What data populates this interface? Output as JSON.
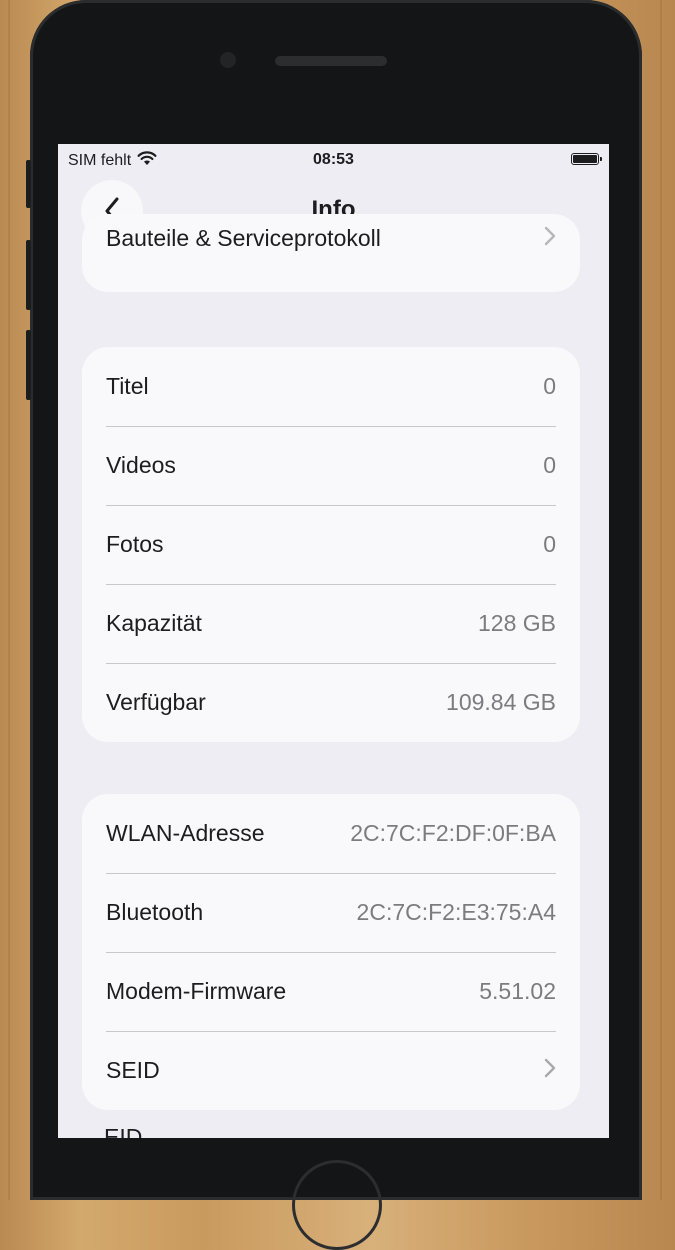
{
  "status_bar": {
    "carrier": "SIM fehlt",
    "time": "08:53",
    "wifi_icon": "wifi-icon",
    "battery_icon": "battery-icon"
  },
  "nav": {
    "title": "Info",
    "back_icon": "chevron-left-icon"
  },
  "top_row": {
    "label": "Bauteile & Serviceprotokoll",
    "chevron": "chevron-right-icon"
  },
  "media_section": {
    "rows": [
      {
        "label": "Titel",
        "value": "0"
      },
      {
        "label": "Videos",
        "value": "0"
      },
      {
        "label": "Fotos",
        "value": "0"
      },
      {
        "label": "Kapazität",
        "value": "128 GB"
      },
      {
        "label": "Verfügbar",
        "value": "109.84 GB"
      }
    ]
  },
  "network_section": {
    "rows": [
      {
        "label": "WLAN-Adresse",
        "value": "2C:7C:F2:DF:0F:BA"
      },
      {
        "label": "Bluetooth",
        "value": "2C:7C:F2:E3:75:A4"
      },
      {
        "label": "Modem-Firmware",
        "value": "5.51.02"
      },
      {
        "label": "SEID",
        "value": ""
      }
    ],
    "partial_next_label": "EID"
  },
  "colors": {
    "background": "#efedf4",
    "card": "#f9f8fb",
    "secondary_text": "#7c7c80",
    "separator": "#c8c7cc"
  }
}
